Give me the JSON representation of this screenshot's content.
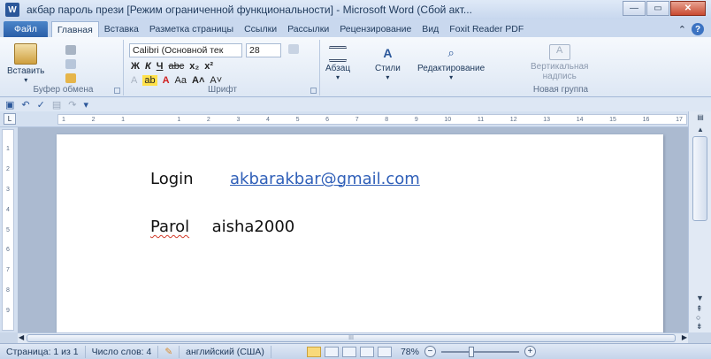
{
  "window": {
    "app_icon": "W",
    "title": "акбар пароль прези [Режим ограниченной функциональности]  -  Microsoft Word (Сбой акт...",
    "minimize_icon": "minimize-icon",
    "maximize_icon": "maximize-icon",
    "close_icon": "close-icon"
  },
  "tabs": [
    "Файл",
    "Главная",
    "Вставка",
    "Разметка страницы",
    "Ссылки",
    "Рассылки",
    "Рецензирование",
    "Вид",
    "Foxit Reader PDF"
  ],
  "active_tab": "Главная",
  "ribbon": {
    "paste_label": "Вставить",
    "clipboard_group": "Буфер обмена",
    "font_name": "Calibri (Основной тек",
    "font_size": "28",
    "font_group": "Шрифт",
    "format_row1": [
      "Ж",
      "К",
      "Ч",
      "abc",
      "x₂",
      "x²"
    ],
    "format_row2": [
      "A",
      "Aa",
      "A˄",
      "A˅"
    ],
    "paragraph_label": "Абзац",
    "styles_label": "Стили",
    "editing_label": "Редактирование",
    "textbox_label_1": "Вертикальная",
    "textbox_label_2": "надпись",
    "new_group": "Новая группа"
  },
  "ruler": {
    "marks": [
      "1",
      "2",
      "1",
      "",
      "1",
      "2",
      "3",
      "4",
      "5",
      "6",
      "7",
      "8",
      "9",
      "10",
      "11",
      "12",
      "13",
      "14",
      "15",
      "16",
      "17"
    ]
  },
  "document": {
    "login_label": "Login",
    "login_value": "akbarakbar@gmail.com",
    "parol_label": "Parol",
    "parol_value": "aisha2000"
  },
  "statusbar": {
    "page": "Страница: 1 из 1",
    "words": "Число слов: 4",
    "language": "английский (США)",
    "zoom": "78%",
    "zoom_level": 0.78
  },
  "colors": {
    "link": "#2f5fb8",
    "file_tab": "#2b5fa8",
    "spell_error": "#d23b2b"
  }
}
